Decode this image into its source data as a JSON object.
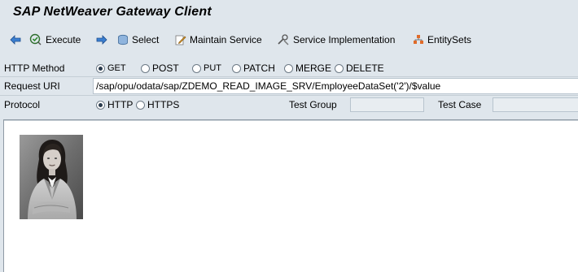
{
  "app": {
    "title": "SAP NetWeaver Gateway Client"
  },
  "toolbar": {
    "back_icon": "arrow-left-icon",
    "execute_label": "Execute",
    "forward_icon": "arrow-right-icon",
    "select_label": "Select",
    "maintain_service_label": "Maintain Service",
    "service_implementation_label": "Service Implementation",
    "entity_sets_label": "EntitySets"
  },
  "form": {
    "http_method_label": "HTTP Method",
    "methods": [
      {
        "label": "GET",
        "selected": true
      },
      {
        "label": "POST",
        "selected": false
      },
      {
        "label": "PUT",
        "selected": false
      },
      {
        "label": "PATCH",
        "selected": false
      },
      {
        "label": "MERGE",
        "selected": false
      },
      {
        "label": "DELETE",
        "selected": false
      }
    ],
    "request_uri_label": "Request URI",
    "request_uri_value": "/sap/opu/odata/sap/ZDEMO_READ_IMAGE_SRV/EmployeeDataSet('2')/$value",
    "protocol_label": "Protocol",
    "protocols": [
      {
        "label": "HTTP",
        "selected": true
      },
      {
        "label": "HTTPS",
        "selected": false
      }
    ],
    "test_group_label": "Test Group",
    "test_group_value": "",
    "test_case_label": "Test Case",
    "test_case_value": ""
  },
  "response": {
    "image_description": "employee-photo"
  },
  "colors": {
    "background": "#dfe6ec",
    "accent_blue": "#1f5fae",
    "field_border": "#b8c4ce"
  }
}
